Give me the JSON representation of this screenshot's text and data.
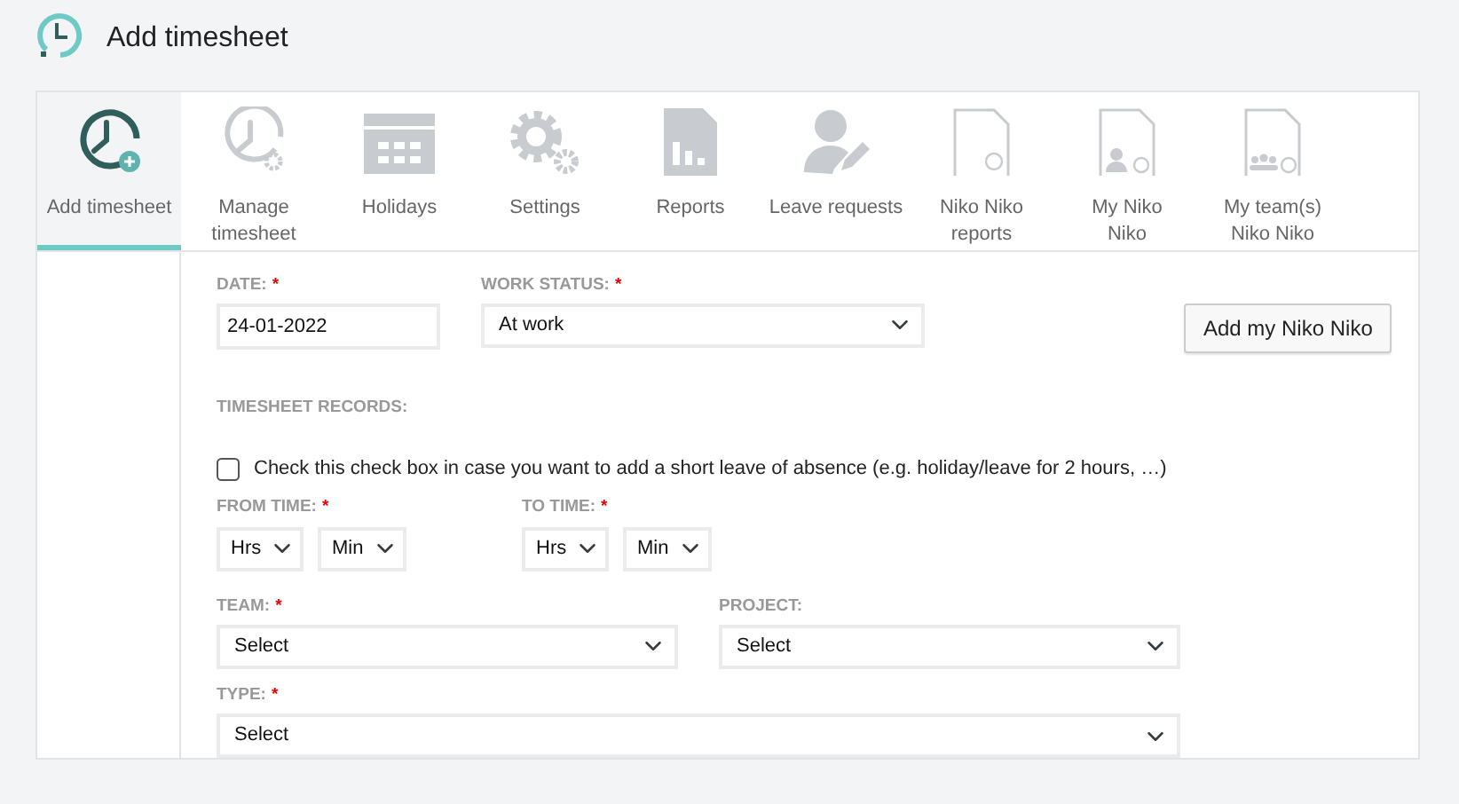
{
  "header": {
    "title": "Add timesheet"
  },
  "tabs": [
    {
      "label": "Add timesheet",
      "selected": true
    },
    {
      "label": "Manage\ntimesheet",
      "selected": false
    },
    {
      "label": "Holidays",
      "selected": false
    },
    {
      "label": "Settings",
      "selected": false
    },
    {
      "label": "Reports",
      "selected": false
    },
    {
      "label": "Leave requests",
      "selected": false
    },
    {
      "label": "Niko Niko\nreports",
      "selected": false
    },
    {
      "label": "My Niko\nNiko",
      "selected": false
    },
    {
      "label": "My team(s)\nNiko Niko",
      "selected": false
    }
  ],
  "form": {
    "date": {
      "label": "DATE:",
      "required_mark": "*",
      "value": "24-01-2022"
    },
    "work_status": {
      "label": "WORK STATUS:",
      "required_mark": "*",
      "value": "At work"
    },
    "niko_button": "Add my Niko Niko",
    "records_heading": "TIMESHEET RECORDS:",
    "short_leave": {
      "label": "Check this check box in case you want to add a short leave of absence (e.g. holiday/leave for 2 hours, …)",
      "checked": false
    },
    "from_time": {
      "label": "FROM TIME:",
      "required_mark": "*",
      "hours": "Hrs",
      "minutes": "Min"
    },
    "to_time": {
      "label": "TO TIME:",
      "required_mark": "*",
      "hours": "Hrs",
      "minutes": "Min"
    },
    "team": {
      "label": "TEAM:",
      "required_mark": "*",
      "value": "Select"
    },
    "project": {
      "label": "PROJECT:",
      "value": "Select"
    },
    "type": {
      "label": "TYPE:",
      "required_mark": "*",
      "value": "Select"
    }
  }
}
